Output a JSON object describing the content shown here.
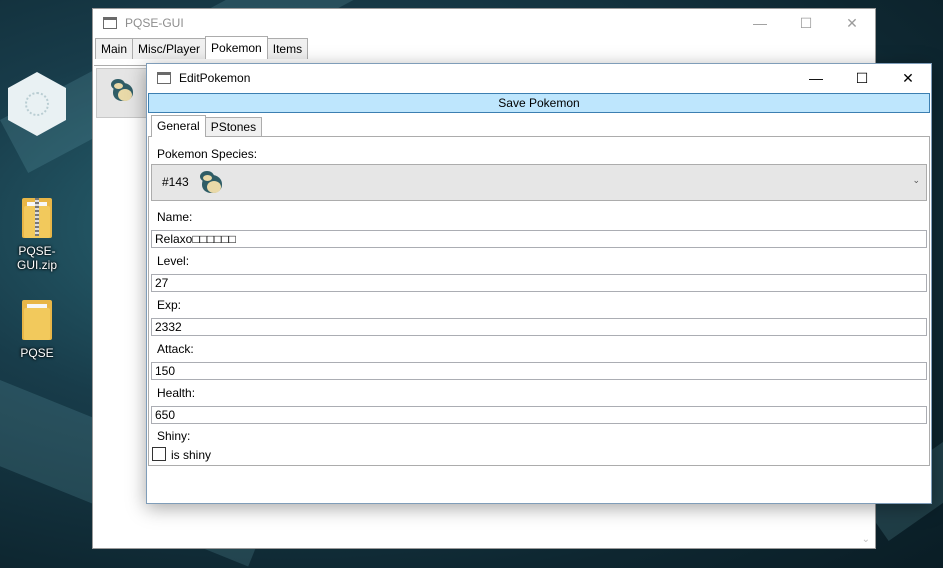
{
  "desktop": {
    "icons": [
      {
        "label": "PQSE-GUI.zip",
        "kind": "zip-folder-icon"
      },
      {
        "label": "PQSE",
        "kind": "folder-icon"
      }
    ]
  },
  "main_window": {
    "title": "PQSE-GUI",
    "controls": {
      "minimize": "—",
      "maximize": "☐",
      "close": "✕"
    },
    "tabs": [
      "Main",
      "Misc/Player",
      "Pokemon",
      "Items"
    ],
    "active_tab": "Pokemon",
    "scroll_arrow": "⌄"
  },
  "edit_window": {
    "title": "EditPokemon",
    "controls": {
      "minimize": "—",
      "maximize": "☐",
      "close": "✕"
    },
    "save_button": "Save Pokemon",
    "tabs": [
      "General",
      "PStones"
    ],
    "active_tab": "General",
    "fields": {
      "species_label": "Pokemon Species:",
      "species_value": "#143",
      "dropdown_arrow": "⌄",
      "name_label": "Name:",
      "name_value": "Relaxo□□□□□□",
      "level_label": "Level:",
      "level_value": "27",
      "exp_label": "Exp:",
      "exp_value": "2332",
      "attack_label": "Attack:",
      "attack_value": "150",
      "health_label": "Health:",
      "health_value": "650",
      "shiny_label": "Shiny:",
      "shiny_checkbox_label": "is shiny",
      "shiny_checked": false
    }
  },
  "colors": {
    "save_button_bg": "#bee6fd",
    "save_button_border": "#3c7fb1",
    "snorlax_body": "#2f5d66",
    "snorlax_belly": "#e9d9a8"
  }
}
